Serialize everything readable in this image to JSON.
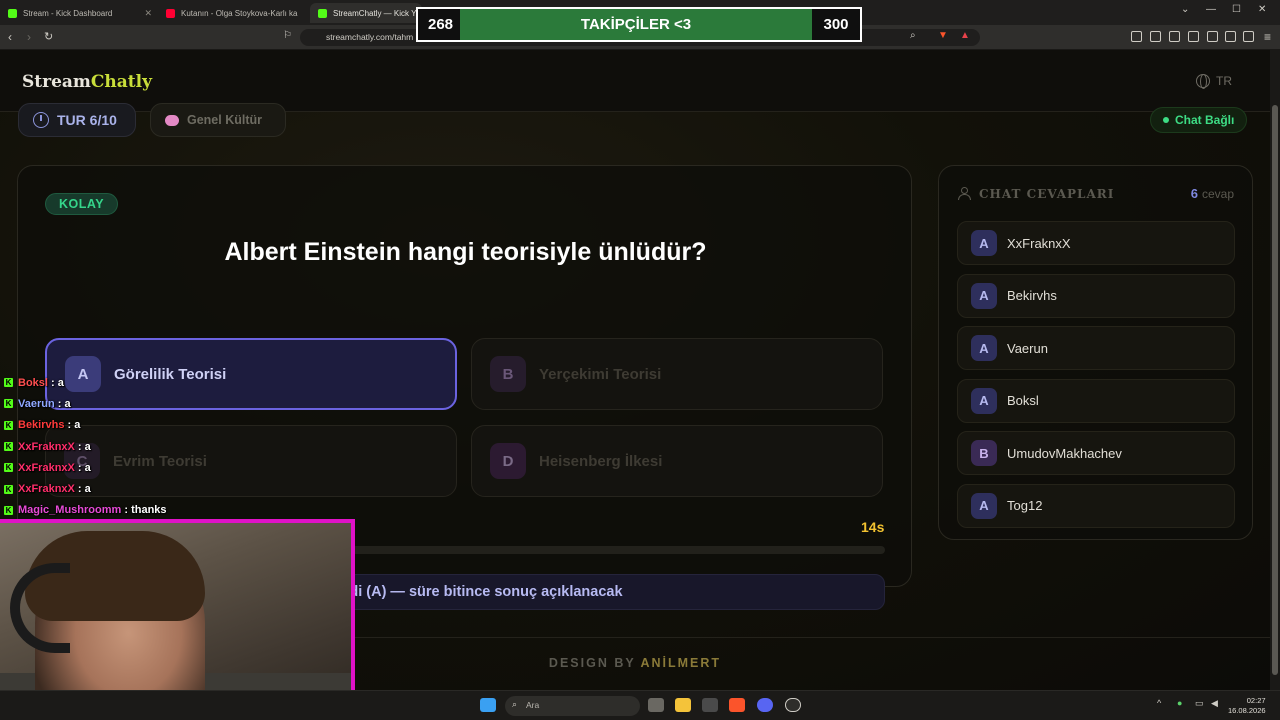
{
  "browser": {
    "tabs": [
      {
        "title": "Stream - Kick Dashboard",
        "favicon_color": "#53fc18"
      },
      {
        "title": "Kutanın - Olga Stoykova-Karlı ka",
        "favicon_color": "#ff0033"
      },
      {
        "title": "StreamChatly — Kick Yayı",
        "favicon_color": "#53fc18"
      }
    ],
    "url": "streamchatly.com/tahm"
  },
  "overlay": {
    "follower_current": "268",
    "follower_label": "TAKİPÇİLER <3",
    "follower_goal": "300"
  },
  "site": {
    "logo_a": "Stream",
    "logo_b": "Chatly",
    "lang": "TR",
    "round": "TUR 6/10",
    "category": "Genel Kültür",
    "chat_status": "Chat Bağlı"
  },
  "quiz": {
    "difficulty": "KOLAY",
    "question": "Albert Einstein hangi teorisiyle ünlüdür?",
    "options": [
      {
        "letter": "A",
        "text": "Görelilik Teorisi"
      },
      {
        "letter": "B",
        "text": "Yerçekimi Teorisi"
      },
      {
        "letter": "C",
        "text": "Evrim Teorisi"
      },
      {
        "letter": "D",
        "text": "Heisenberg İlkesi"
      }
    ],
    "timer_label": "14s",
    "timer_progress": 0.33,
    "status_text": "ydedildi (A) — süre bitince sonuç açıklanacak"
  },
  "answers": {
    "title": "CHAT CEVAPLARI",
    "count": "6",
    "count_label": "cevap",
    "items": [
      {
        "letter": "A",
        "name": "XxFraknxX"
      },
      {
        "letter": "A",
        "name": "Bekirvhs"
      },
      {
        "letter": "A",
        "name": "Vaerun"
      },
      {
        "letter": "A",
        "name": "Boksl"
      },
      {
        "letter": "B",
        "name": "UmudovMakhachev"
      },
      {
        "letter": "A",
        "name": "Tog12"
      }
    ]
  },
  "footer": {
    "prefix": "DESIGN BY",
    "brand": "ANİLMERT"
  },
  "stream_chat": [
    {
      "user": "Boksl",
      "color": "#ff4f4f",
      "msg": "a"
    },
    {
      "user": "Vaerun",
      "color": "#8fa8ff",
      "msg": "a"
    },
    {
      "user": "Bekirvhs",
      "color": "#ff3b3b",
      "msg": "a"
    },
    {
      "user": "XxFraknxX",
      "color": "#ff2f6a",
      "msg": "a"
    },
    {
      "user": "XxFraknxX",
      "color": "#ff2f6a",
      "msg": "a"
    },
    {
      "user": "XxFraknxX",
      "color": "#ff2f6a",
      "msg": "a"
    },
    {
      "user": "Magic_Mushroomm",
      "color": "#e64bd6",
      "msg": "thanks"
    }
  ],
  "taskbar": {
    "search_placeholder": "Ara",
    "time": "02:27",
    "date": "16.08.2026"
  }
}
